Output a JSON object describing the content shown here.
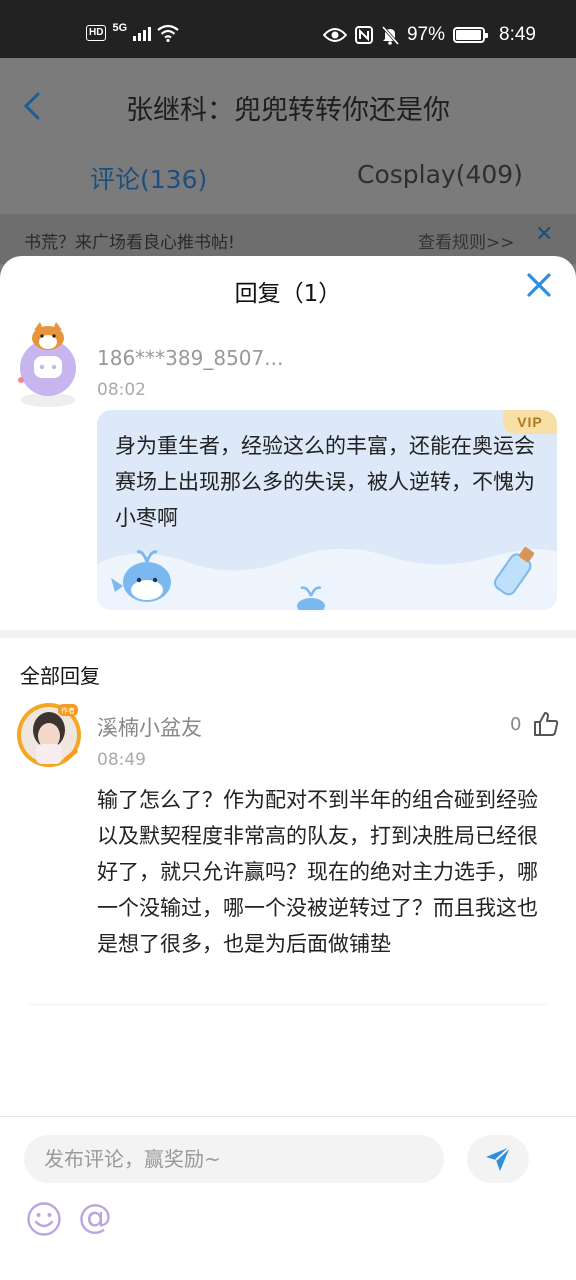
{
  "statusbar": {
    "hd": "HD",
    "net": "5G",
    "battery": "97%",
    "time": "8:49"
  },
  "background_page": {
    "back_icon": "chevron-left-icon",
    "title": "张继科：兜兜转转你还是你",
    "tabs": [
      "评论(136)",
      "Cosplay(409)"
    ],
    "notice": "书荒？来广场看良心推书帖!",
    "rules_link": "查看规则>>"
  },
  "sheet": {
    "title": "回复（1）",
    "original": {
      "username": "186***389_8507...",
      "time": "08:02",
      "badge": "VIP",
      "text": "身为重生者，经验这么的丰富，还能在奥运会赛场上出现那么多的失误，被人逆转，不愧为小枣啊"
    },
    "section_title": "全部回复",
    "replies": [
      {
        "username": "溪楠小盆友",
        "time": "08:49",
        "likes": "0",
        "text": "输了怎么了？作为配对不到半年的组合碰到经验以及默契程度非常高的队友，打到决胜局已经很好了，就只允许赢吗？现在的绝对主力选手，哪一个没输过，哪一个没被逆转过了？而且我这也是想了很多，也是为后面做铺垫"
      }
    ]
  },
  "input": {
    "placeholder": "发布评论，赢奖励~",
    "at_symbol": "@"
  },
  "colors": {
    "accent": "#2e8ee0",
    "bubble_bg": "#dde9f9",
    "vip_bg": "#f7dfa6",
    "purple": "#b9a6e0"
  }
}
